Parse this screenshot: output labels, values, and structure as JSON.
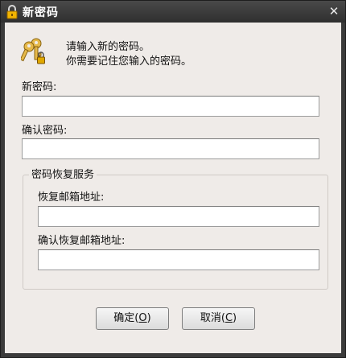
{
  "window": {
    "title": "新密码",
    "title_icon": "lock-icon",
    "close_label": "✕"
  },
  "message": {
    "line1": "请输入新的密码。",
    "line2": "你需要记住您输入的密码。",
    "icon": "keys-icon"
  },
  "fields": {
    "new_password": {
      "label": "新密码:",
      "value": ""
    },
    "confirm_password": {
      "label": "确认密码:",
      "value": ""
    }
  },
  "recovery": {
    "group_title": "密码恢复服务",
    "email": {
      "label": "恢复邮箱地址:",
      "value": ""
    },
    "confirm_email": {
      "label": "确认恢复邮箱地址:",
      "value": ""
    }
  },
  "buttons": {
    "ok": {
      "label": "确定(",
      "mnemonic": "O",
      "suffix": ")"
    },
    "cancel": {
      "label": "取消(",
      "mnemonic": "C",
      "suffix": ")"
    }
  }
}
